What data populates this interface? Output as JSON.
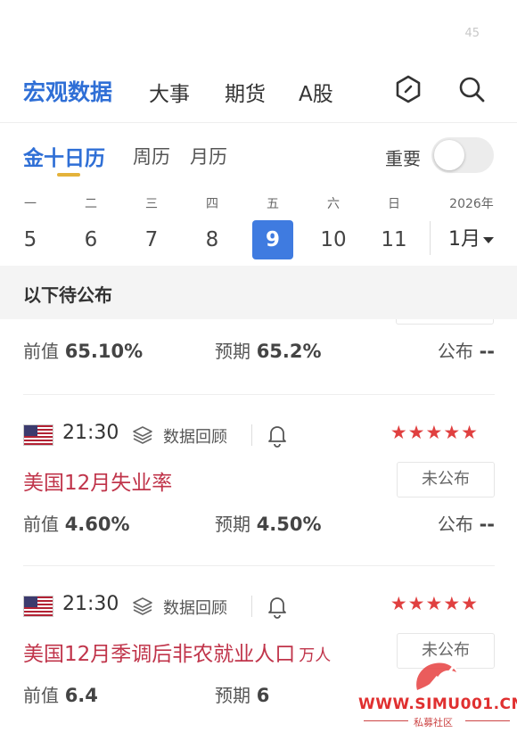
{
  "status": {
    "right_text": "45"
  },
  "top_nav": {
    "tabs": [
      {
        "label": "宏观数据",
        "active": true
      },
      {
        "label": "大事",
        "active": false
      },
      {
        "label": "期货",
        "active": false
      },
      {
        "label": "A股",
        "active": false
      }
    ],
    "icons": [
      "hexagon-icon",
      "search-icon"
    ]
  },
  "sub_nav": {
    "tabs": [
      {
        "label": "金十日历",
        "active": true
      },
      {
        "label": "周历",
        "active": false
      },
      {
        "label": "月历",
        "active": false
      }
    ],
    "important_label": "重要",
    "important_on": false
  },
  "week": {
    "days": [
      {
        "weekday": "一",
        "date": "5"
      },
      {
        "weekday": "二",
        "date": "6"
      },
      {
        "weekday": "三",
        "date": "7"
      },
      {
        "weekday": "四",
        "date": "8"
      },
      {
        "weekday": "五",
        "date": "9",
        "selected": true
      },
      {
        "weekday": "六",
        "date": "10"
      },
      {
        "weekday": "日",
        "date": "11"
      }
    ],
    "year": "2026年",
    "month": "1月"
  },
  "banner": {
    "label": "以下待公布"
  },
  "events": [
    {
      "prev_label": "前值",
      "prev": "65.10%",
      "forecast_label": "预期",
      "forecast": "65.2%",
      "pub_label": "公布",
      "pub": "--"
    },
    {
      "time": "21:30",
      "review_label": "数据回顾",
      "stars": "★★★★★",
      "title": "美国12月失业率",
      "unit": "",
      "status": "未公布",
      "prev_label": "前值",
      "prev": "4.60%",
      "forecast_label": "预期",
      "forecast": "4.50%",
      "pub_label": "公布",
      "pub": "--"
    },
    {
      "time": "21:30",
      "review_label": "数据回顾",
      "stars": "★★★★★",
      "title": "美国12月季调后非农就业人口",
      "unit": "万人",
      "status": "未公布",
      "prev_label": "前值",
      "prev": "6.4",
      "forecast_label": "预期",
      "forecast": "6"
    }
  ],
  "colors": {
    "accent": "#2f6fd6",
    "star": "#e04040",
    "title": "#c0344a",
    "underline": "#e4b23a"
  },
  "watermark": {
    "text": "WWW.SIMU001.CN",
    "sub": "私募社区"
  }
}
